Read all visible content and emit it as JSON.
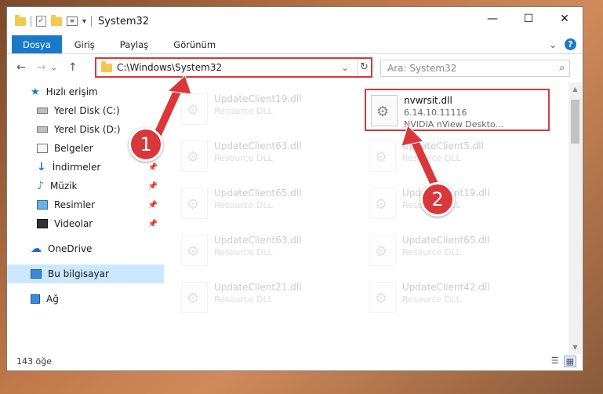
{
  "window": {
    "title": "System32",
    "controls": {
      "minimize": "—",
      "maximize": "☐",
      "close": "✕"
    }
  },
  "ribbon": {
    "tabs": [
      "Dosya",
      "Giriş",
      "Paylaş",
      "Görünüm"
    ],
    "expand_icon": "⌄",
    "help_icon": "?"
  },
  "navigation": {
    "back": "←",
    "forward": "→",
    "recent": "⌄",
    "up": "↑",
    "address_path": "C:\\Windows\\System32",
    "dropdown": "⌄",
    "refresh": "↻",
    "search_placeholder": "Ara: System32",
    "search_icon": "⌕"
  },
  "sidebar": {
    "items": [
      {
        "label": "Hızlı erişim",
        "icon": "star-icon",
        "pinned": false
      },
      {
        "label": "Yerel Disk (C:)",
        "icon": "disk-icon",
        "pinned": false
      },
      {
        "label": "Yerel Disk (D:)",
        "icon": "disk-icon",
        "pinned": false
      },
      {
        "label": "Belgeler",
        "icon": "document-icon",
        "pinned": false
      },
      {
        "label": "İndirmeler",
        "icon": "download-icon",
        "pinned": true
      },
      {
        "label": "Müzik",
        "icon": "music-icon",
        "pinned": true
      },
      {
        "label": "Resimler",
        "icon": "pictures-icon",
        "pinned": true
      },
      {
        "label": "Videolar",
        "icon": "video-icon",
        "pinned": true
      },
      {
        "label": "OneDrive",
        "icon": "cloud-icon",
        "pinned": false
      },
      {
        "label": "Bu bilgisayar",
        "icon": "computer-icon",
        "pinned": false,
        "selected": true
      },
      {
        "label": "Ağ",
        "icon": "network-icon",
        "pinned": false
      }
    ],
    "pin_glyph": "📌"
  },
  "files": {
    "highlighted": {
      "name": "nvwrsit.dll",
      "version": "6.14.10.11116",
      "description": "NVIDIA nView Deskto..."
    },
    "faded": [
      {
        "name": "UpdateClient19.dll",
        "type": "Resource DLL"
      },
      {
        "name": "UpdateClient63.dll",
        "type": "Resource DLL"
      },
      {
        "name": "UpdateClient5.dll",
        "type": "Resource DLL"
      },
      {
        "name": "UpdateClient65.dll",
        "type": "Resource DLL"
      },
      {
        "name": "UpdateClient19.dll",
        "type": "Resource DLL"
      },
      {
        "name": "UpdateClient63.dll",
        "type": "Resource DLL"
      },
      {
        "name": "UpdateClient65.dll",
        "type": "Resource DLL"
      },
      {
        "name": "UpdateClient21.dll",
        "type": "Resource DLL"
      },
      {
        "name": "UpdateClient42.dll",
        "type": "Resource DLL"
      }
    ]
  },
  "status": {
    "item_count": "143 öğe",
    "details_view": "☰",
    "tiles_view": "▦"
  },
  "annotations": {
    "badge1": "1",
    "badge2": "2",
    "accent": "#d9373a"
  }
}
